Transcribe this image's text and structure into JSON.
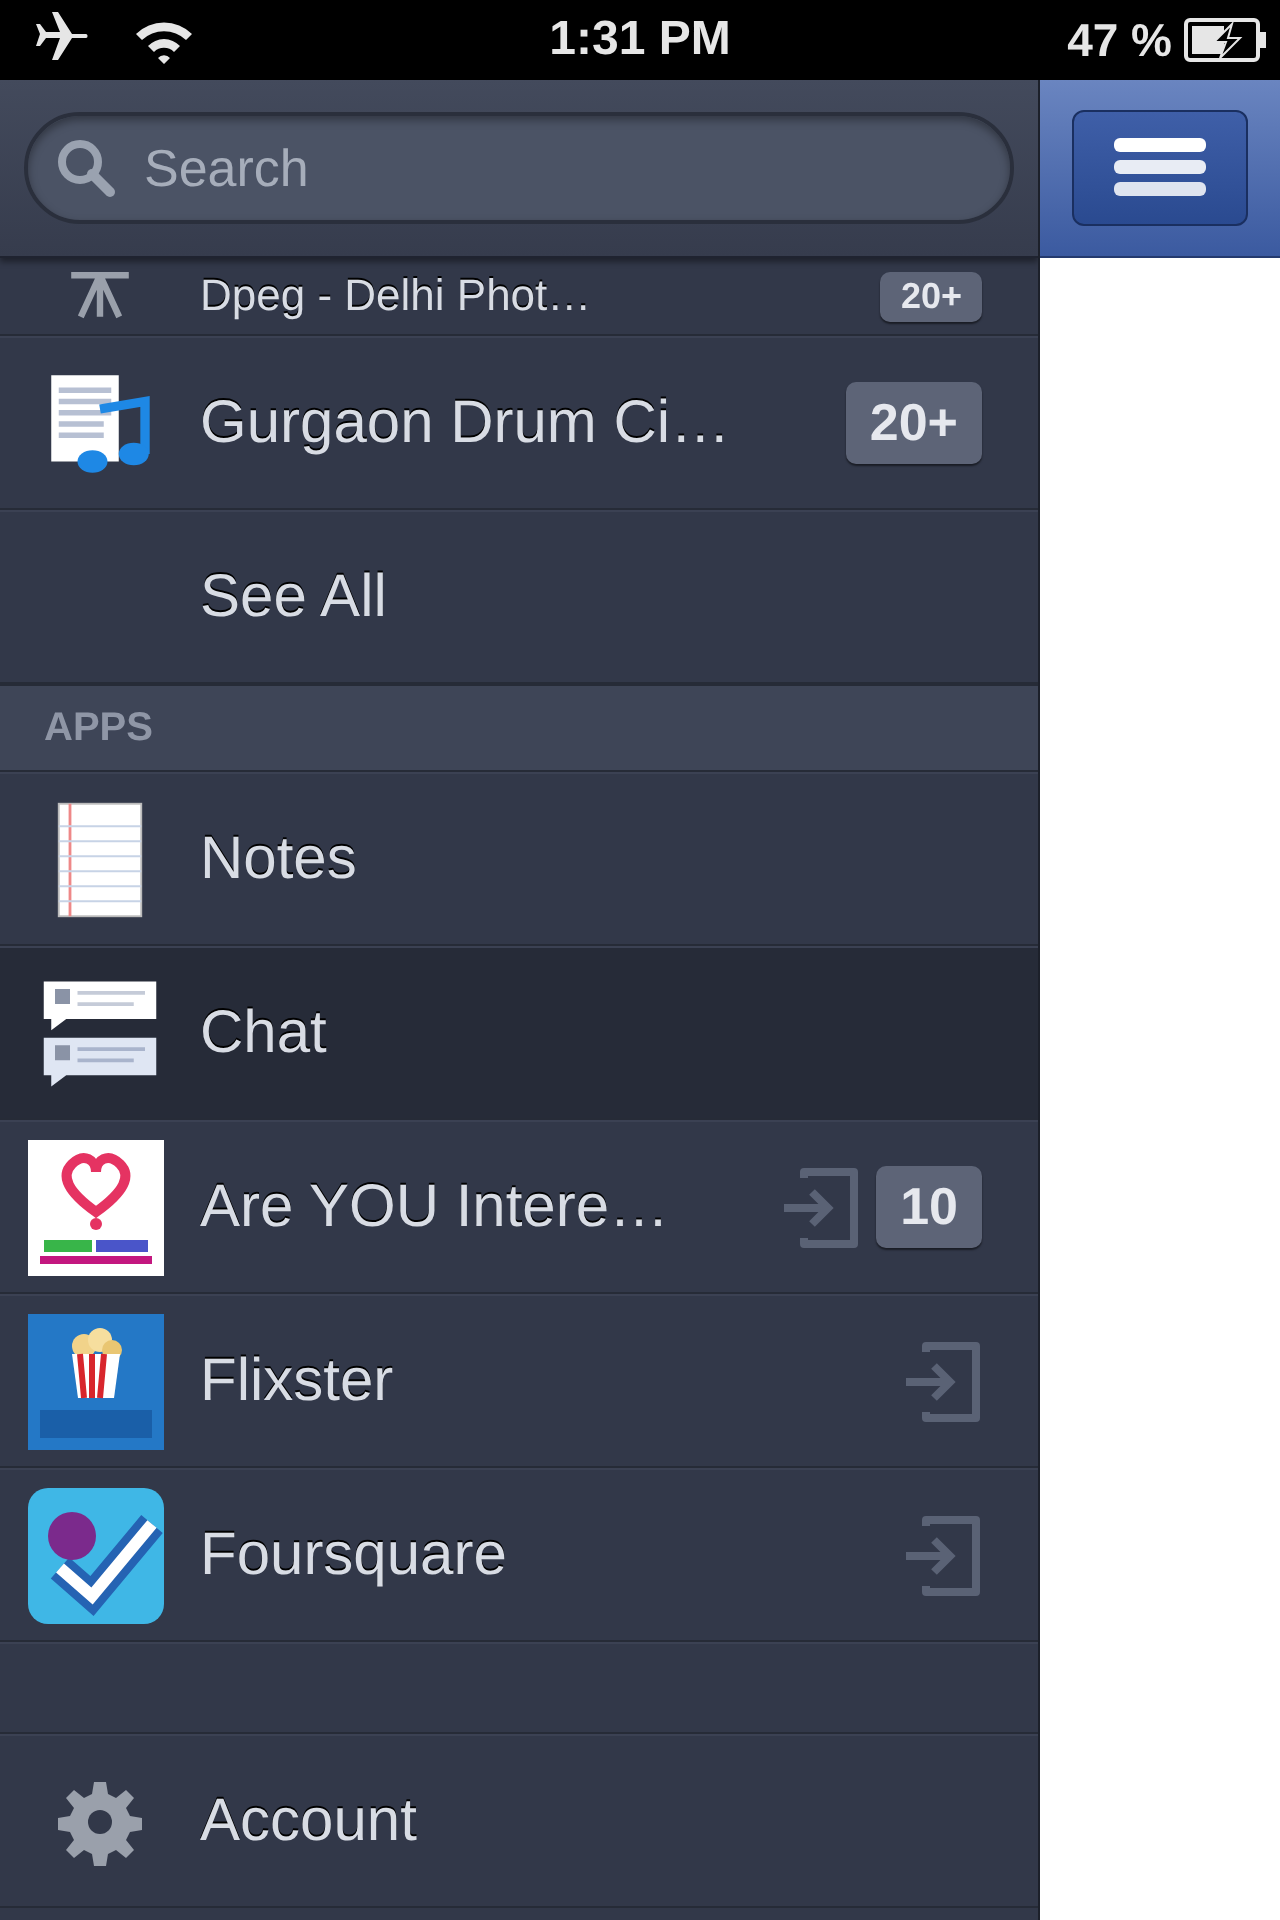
{
  "status_bar": {
    "time": "1:31 PM",
    "battery": "47 %",
    "airplane": true,
    "charging": true
  },
  "search": {
    "placeholder": "Search"
  },
  "groups": [
    {
      "label": "Dpeg - Delhi Phot…",
      "badge": "20+",
      "selected": false
    },
    {
      "label": "Gurgaon Drum Ci…",
      "badge": "20+",
      "selected": false
    },
    {
      "label": "See All",
      "selected": false
    }
  ],
  "apps_section": {
    "title": "APPS"
  },
  "apps": [
    {
      "label": "Notes",
      "selected": false,
      "login": false
    },
    {
      "label": "Chat",
      "selected": true,
      "login": false
    },
    {
      "label": "Are YOU Intere…",
      "selected": false,
      "login": true,
      "badge": "10"
    },
    {
      "label": "Flixster",
      "selected": false,
      "login": true
    },
    {
      "label": "Foursquare",
      "selected": false,
      "login": true
    }
  ],
  "footer": {
    "label": "Account"
  }
}
